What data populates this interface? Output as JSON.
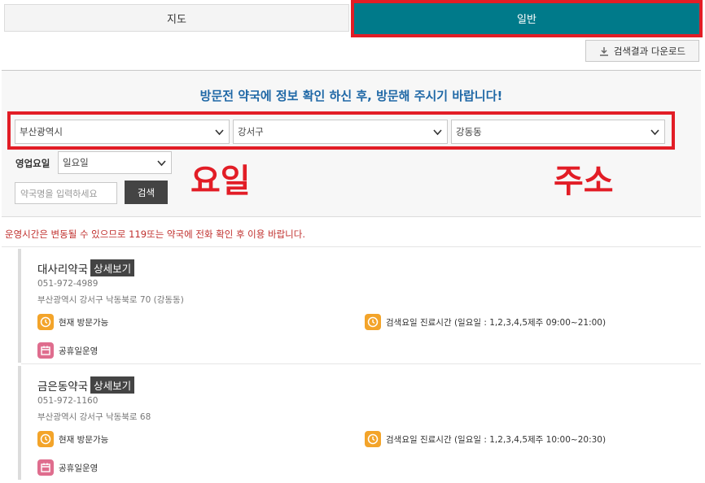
{
  "tabs": {
    "map": "지도",
    "general": "일반"
  },
  "download_label": "검색결과 다운로드",
  "notice": "방문전 약국에 정보 확인 하신 후, 방문해 주시기 바랍니다!",
  "filters": {
    "city": "부산광역시",
    "district": "강서구",
    "dong": "강동동",
    "day_label": "영업요일",
    "day_value": "일요일",
    "search_placeholder": "약국명을 입력하세요",
    "search_button": "검색"
  },
  "annotations": {
    "day": "요일",
    "address": "주소",
    "color": "#e21d26"
  },
  "warning": "운영시간은 변동될 수 있으므로 119또는 약국에 전화 확인 후 이용 바랍니다.",
  "colors": {
    "accent": "#007a8a",
    "notice": "#1f68a6",
    "warning": "#c0302e",
    "clock": "#f3a42a",
    "calendar": "#df6d8e"
  },
  "results": [
    {
      "name": "대사리약국",
      "detail": "상세보기",
      "phone": "051-972-4989",
      "address": "부산광역시 강서구 낙동북로 70 (강동동)",
      "status": "현재 방문가능",
      "hours": "검색요일 진료시간 (일요일 : 1,2,3,4,5제주 09:00~21:00)",
      "holiday": "공휴일운영"
    },
    {
      "name": "금은동약국",
      "detail": "상세보기",
      "phone": "051-972-1160",
      "address": "부산광역시 강서구 낙동북로 68",
      "status": "현재 방문가능",
      "hours": "검색요일 진료시간 (일요일 : 1,2,3,4,5제주 10:00~20:30)",
      "holiday": "공휴일운영"
    }
  ]
}
